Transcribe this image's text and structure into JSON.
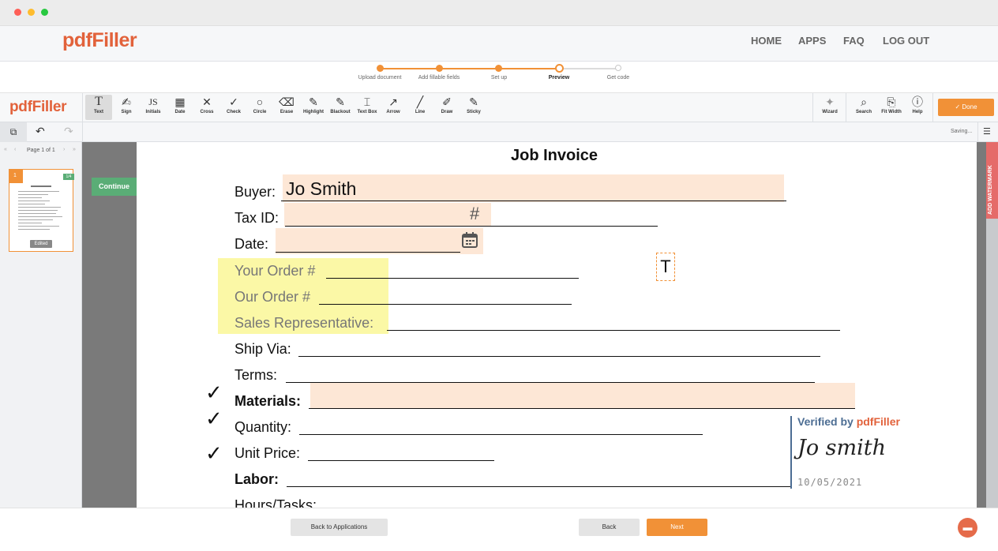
{
  "chrome": {
    "dot_colors": [
      "#fe5f57",
      "#febc2e",
      "#28c840"
    ]
  },
  "site": {
    "logo": "pdfFiller",
    "nav": [
      "HOME",
      "APPS",
      "FAQ",
      "LOG OUT"
    ]
  },
  "steps": [
    {
      "label": "Upload document",
      "state": "done"
    },
    {
      "label": "Add fillable fields",
      "state": "done"
    },
    {
      "label": "Set up",
      "state": "done"
    },
    {
      "label": "Preview",
      "state": "current"
    },
    {
      "label": "Get code",
      "state": "todo"
    }
  ],
  "toolbar": {
    "logo": "pdfFiller",
    "tools": [
      {
        "label": "Text",
        "icon": "T"
      },
      {
        "label": "Sign",
        "icon": "✍"
      },
      {
        "label": "Initials",
        "icon": "JS"
      },
      {
        "label": "Date",
        "icon": "▦"
      },
      {
        "label": "Cross",
        "icon": "✕"
      },
      {
        "label": "Check",
        "icon": "✓"
      },
      {
        "label": "Circle",
        "icon": "○"
      },
      {
        "label": "Erase",
        "icon": "⌫"
      },
      {
        "label": "Highlight",
        "icon": "✎"
      },
      {
        "label": "Blackout",
        "icon": "✎"
      },
      {
        "label": "Text Box",
        "icon": "⌶"
      },
      {
        "label": "Arrow",
        "icon": "↗"
      },
      {
        "label": "Line",
        "icon": "╱"
      },
      {
        "label": "Draw",
        "icon": "✐"
      },
      {
        "label": "Sticky",
        "icon": "✎"
      }
    ],
    "wizard_label": "Wizard",
    "search_label": "Search",
    "fitwidth_label": "Fit Width",
    "help_label": "Help",
    "done_label": "✓ Done"
  },
  "subbar": {
    "status": "Saving..."
  },
  "pager": {
    "label": "Page 1 of 1",
    "thumb_number": "1",
    "thumb_badge": "1/4",
    "thumb_status": "Edited"
  },
  "document": {
    "title": "Job Invoice",
    "continue_label": "Continue",
    "buyer_label": "Buyer:",
    "buyer_value": "Jo Smith",
    "taxid_label": "Tax ID:",
    "taxid_icon": "#",
    "date_label": "Date:",
    "your_order_label": "Your Order #",
    "our_order_label": "Our Order #",
    "sales_rep_label": "Sales Representative:",
    "ship_via_label": "Ship Via:",
    "terms_label": "Terms:",
    "materials_label": "Materials:",
    "quantity_label": "Quantity:",
    "unit_price_label": "Unit Price:",
    "labor_label": "Labor:",
    "hours_label": "Hours/Tasks:",
    "text_cursor": "T",
    "verified_prefix": "Verified by",
    "verified_brand": "pdfFiller",
    "signature": "Jo smith",
    "signature_date": "10/05/2021"
  },
  "watermark_tab": "ADD WATERMARK",
  "bottom": {
    "back_to_apps": "Back to Applications",
    "back": "Back",
    "next": "Next"
  },
  "colors": {
    "brand": "#e2623b",
    "accent": "#f19137",
    "field_orange": "#fde7d6",
    "field_yellow": "#fbf8a6",
    "continue_green": "#5aad76",
    "verified_blue": "#4c6d93"
  }
}
